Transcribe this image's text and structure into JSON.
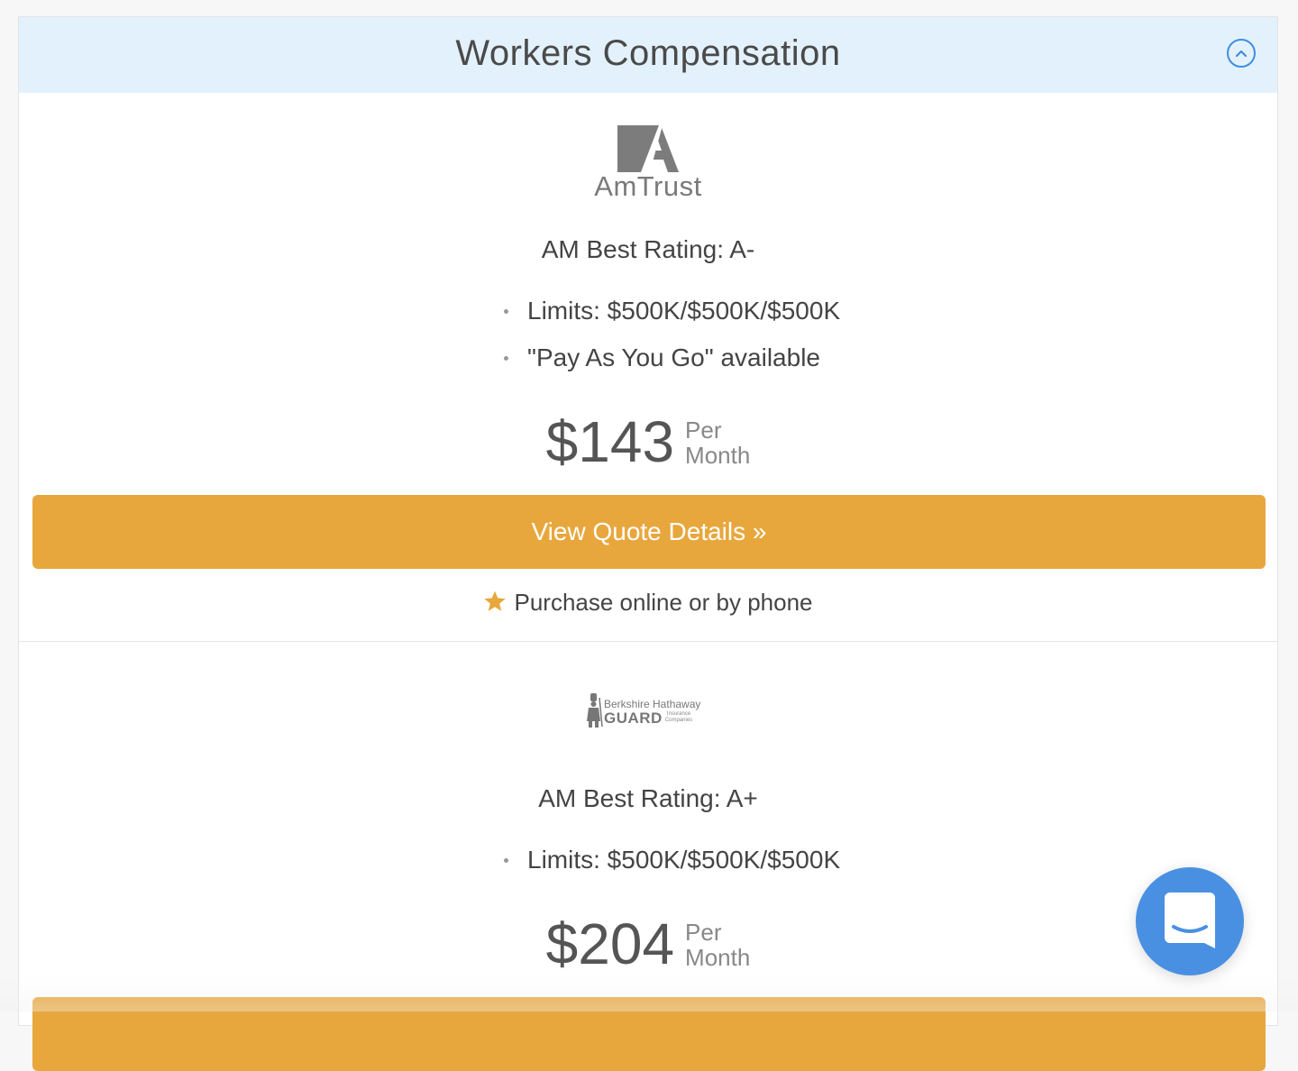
{
  "section": {
    "title": "Workers Compensation",
    "collapse_icon": "chevron-up-circle-icon"
  },
  "quotes": [
    {
      "carrier_logo": "AmTrust",
      "rating": "AM Best Rating: A-",
      "features": [
        "Limits: $500K/$500K/$500K",
        "\"Pay As You Go\" available"
      ],
      "price": "$143",
      "period_line1": "Per",
      "period_line2": "Month",
      "cta_label": "View Quote Details »",
      "purchase_note": "Purchase online or by phone"
    },
    {
      "carrier_logo_line1": "Berkshire Hathaway",
      "carrier_logo_line2": "GUARD",
      "carrier_logo_line3": "Insurance Companies",
      "rating": "AM Best Rating: A+",
      "features": [
        "Limits: $500K/$500K/$500K"
      ],
      "price": "$204",
      "period_line1": "Per",
      "period_line2": "Month"
    }
  ],
  "colors": {
    "header_bg": "#e3f1fd",
    "accent_blue": "#3f8ee0",
    "cta_orange": "#e8a73d",
    "chat_blue": "#4a90e2"
  },
  "chat": {
    "icon": "chat-bubble-icon"
  }
}
